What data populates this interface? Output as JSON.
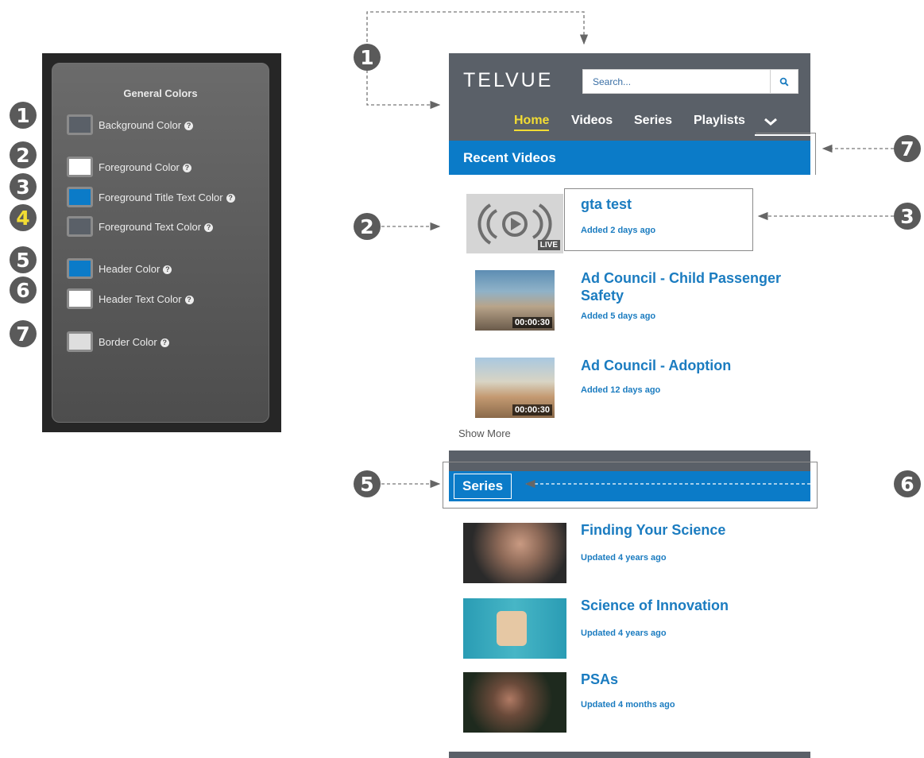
{
  "panel": {
    "title": "General Colors",
    "rows": [
      {
        "callout": "1",
        "label": "Background Color",
        "swatch": "#5a6068"
      },
      {
        "callout": "2",
        "label": "Foreground Color",
        "swatch": "#ffffff"
      },
      {
        "callout": "3",
        "label": "Foreground Title Text Color",
        "swatch": "#0b7bc8"
      },
      {
        "callout": "4",
        "label": "Foreground Text Color",
        "swatch": "#5a6068"
      },
      {
        "callout": "5",
        "label": "Header Color",
        "swatch": "#0b7bc8"
      },
      {
        "callout": "6",
        "label": "Header Text Color",
        "swatch": "#ffffff"
      },
      {
        "callout": "7",
        "label": "Border Color",
        "swatch": "#dedede"
      }
    ],
    "help_glyph": "?"
  },
  "preview": {
    "logo": "TELVUE",
    "search": {
      "placeholder": "Search..."
    },
    "nav": [
      "Home",
      "Videos",
      "Series",
      "Playlists"
    ],
    "recent": {
      "title": "Recent Videos",
      "items": [
        {
          "title": "gta test",
          "meta": "Added 2 days ago",
          "badge": "LIVE"
        },
        {
          "title": "Ad Council - Child Passenger Safety",
          "meta": "Added 5 days ago",
          "duration": "00:00:30"
        },
        {
          "title": "Ad Council - Adoption",
          "meta": "Added 12 days ago",
          "duration": "00:00:30"
        }
      ],
      "show_more": "Show More"
    },
    "series": {
      "title": "Series",
      "items": [
        {
          "title": "Finding Your Science",
          "meta": "Updated 4 years ago"
        },
        {
          "title": "Science of Innovation",
          "meta": "Updated 4 years ago"
        },
        {
          "title": "PSAs",
          "meta": "Updated 4 months ago"
        }
      ]
    }
  },
  "callouts": {
    "c1": "1",
    "c2": "2",
    "c3": "3",
    "c5": "5",
    "c6": "6",
    "c7": "7"
  },
  "colors": {
    "accent": "#0b7bc8",
    "background": "#5a6068",
    "nav_active": "#f2dc33"
  }
}
